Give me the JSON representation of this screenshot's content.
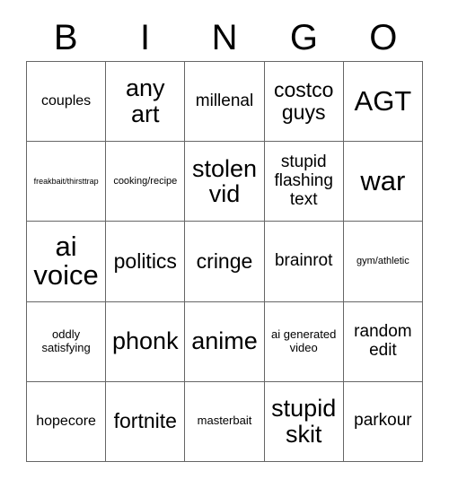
{
  "card": {
    "header_letters": [
      "B",
      "I",
      "N",
      "G",
      "O"
    ],
    "columns": 5,
    "rows": 5,
    "border_color": "#666666",
    "background_color": "#ffffff",
    "text_color": "#000000",
    "cells": [
      {
        "text": "couples",
        "size": "m"
      },
      {
        "text": "any art",
        "size": "xl"
      },
      {
        "text": "millenal",
        "size": "ml"
      },
      {
        "text": "costco guys",
        "size": "l"
      },
      {
        "text": "AGT",
        "size": "xxl"
      },
      {
        "text": "freakbait/thirsttrap",
        "size": "xxs"
      },
      {
        "text": "cooking/recipe",
        "size": "xs"
      },
      {
        "text": "stolen vid",
        "size": "xl"
      },
      {
        "text": "stupid flashing text",
        "size": "ml"
      },
      {
        "text": "war",
        "size": "xxl"
      },
      {
        "text": "ai voice",
        "size": "xxl"
      },
      {
        "text": "politics",
        "size": "l"
      },
      {
        "text": "cringe",
        "size": "l"
      },
      {
        "text": "brainrot",
        "size": "ml"
      },
      {
        "text": "gym/athletic",
        "size": "xs"
      },
      {
        "text": "oddly satisfying",
        "size": "s"
      },
      {
        "text": "phonk",
        "size": "xl"
      },
      {
        "text": "anime",
        "size": "xl"
      },
      {
        "text": "ai generated video",
        "size": "s"
      },
      {
        "text": "random edit",
        "size": "ml"
      },
      {
        "text": "hopecore",
        "size": "m"
      },
      {
        "text": "fortnite",
        "size": "l"
      },
      {
        "text": "masterbait",
        "size": "s"
      },
      {
        "text": "stupid skit",
        "size": "xl"
      },
      {
        "text": "parkour",
        "size": "ml"
      }
    ]
  }
}
